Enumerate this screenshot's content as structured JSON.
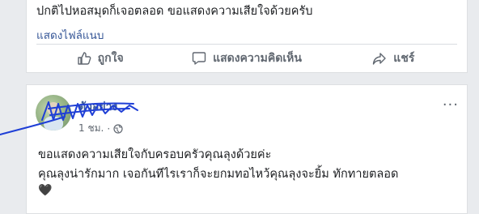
{
  "top_post": {
    "text": "ปกติไปหอสมุดก็เจอตลอด ขอแสดงความเสียใจด้วยครับ",
    "attachment_link": "แสดงไฟล์แนบ",
    "actions": {
      "like": "ถูกใจ",
      "comment": "แสดงความคิดเห็น",
      "share": "แชร์"
    }
  },
  "comment_post": {
    "author": "ตัวอย่าง",
    "time": "1 ชม.",
    "line1": "ขอแสดงความเสียใจกับครอบครัวคุณลุงด้วยค่ะ",
    "line2": "คุณลุงน่ารักมาก เจอกันทีไรเราก็จะยกมทอไหว้คุณลุงจะยิ้ม ทักทายตลอด",
    "emoji": "🖤",
    "more_glyph": "···"
  },
  "colors": {
    "link": "#385898",
    "scribble": "#1f3fd6",
    "background": "#e9ebee"
  }
}
